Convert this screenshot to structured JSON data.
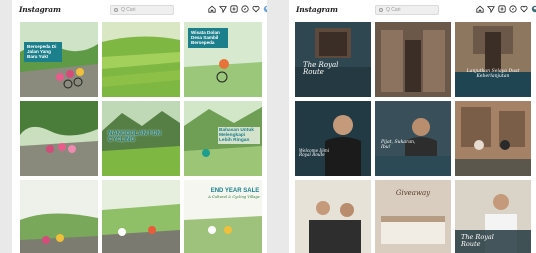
{
  "screens": {
    "left": {
      "app_logo": "Instagram",
      "search_placeholder": "Q Cari",
      "nav_icons": [
        "home-icon",
        "send-icon",
        "add-post-icon",
        "explore-icon",
        "heart-icon",
        "profile-icon"
      ],
      "posts": [
        {
          "caption": "Bersepeda Di Jalan Yang Baru Yuk!"
        },
        {
          "caption": ""
        },
        {
          "caption": "Wisata Dolan Desa Sambil Bersepeda"
        },
        {
          "caption": ""
        },
        {
          "caption": "NANGGULAN FUN CYCLING"
        },
        {
          "caption": "Bahasan Untuk Melengkapi Lebih Ringan"
        },
        {
          "caption": ""
        },
        {
          "caption": ""
        },
        {
          "caption_title": "END YEAR SALE",
          "caption_sub": "A Cultural & Cycling Village"
        }
      ]
    },
    "right": {
      "app_logo": "Instagram",
      "search_placeholder": "Q Cari",
      "nav_icons": [
        "home-icon",
        "send-icon",
        "add-post-icon",
        "explore-icon",
        "heart-icon",
        "profile-icon"
      ],
      "posts": [
        {
          "caption": "The Royal Route"
        },
        {
          "caption": ""
        },
        {
          "caption": "Lanjutkan Selaya Dust Keberlanjutan"
        },
        {
          "caption": "Welcome Ijimi Royal Route"
        },
        {
          "caption": "Pijat, Sukaran, Ibu!"
        },
        {
          "caption": ""
        },
        {
          "caption": ""
        },
        {
          "caption": "Giveaway"
        },
        {
          "caption": "The Royal Route"
        }
      ]
    }
  }
}
